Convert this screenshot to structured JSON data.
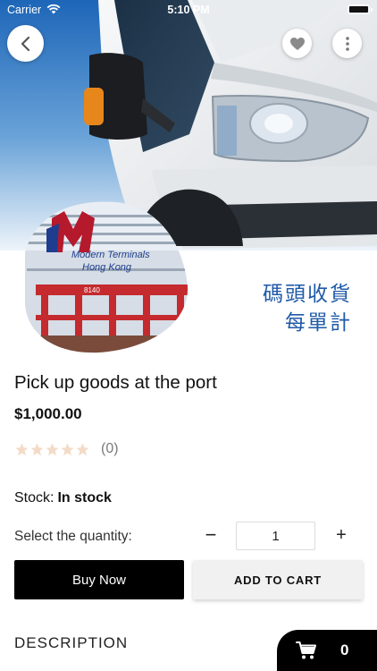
{
  "status_bar": {
    "carrier": "Carrier",
    "time": "5:10 PM"
  },
  "hero": {
    "image_subject": "white delivery van with container terminal photo",
    "logo_text_line1": "Modern Terminals",
    "logo_text_line2": "Hong Kong",
    "crane_label": "8140",
    "promo_line1": "碼頭收貨",
    "promo_line2": "每單計"
  },
  "icons": {
    "back": "chevron-left-icon",
    "favorite": "heart-icon",
    "more": "more-vertical-icon",
    "star": "star-icon",
    "cart": "cart-icon"
  },
  "product": {
    "title": "Pick up goods at the port",
    "price": "$1,000.00",
    "rating": 0,
    "rating_max": 5,
    "review_count": "(0)",
    "stock_label": "Stock:",
    "stock_value": "In stock"
  },
  "quantity": {
    "label": "Select the quantity:",
    "minus": "−",
    "plus": "+",
    "value": "1"
  },
  "actions": {
    "buy_now": "Buy Now",
    "add_to_cart": "ADD TO CART"
  },
  "description": {
    "heading": "DESCRIPTION"
  },
  "cart": {
    "count": "0"
  },
  "colors": {
    "primary": "#000000",
    "secondary_button": "#f1f1f1",
    "promo_text": "#1f5aa8",
    "star_empty": "#f3dcc7",
    "muted": "#7a7a7a"
  }
}
